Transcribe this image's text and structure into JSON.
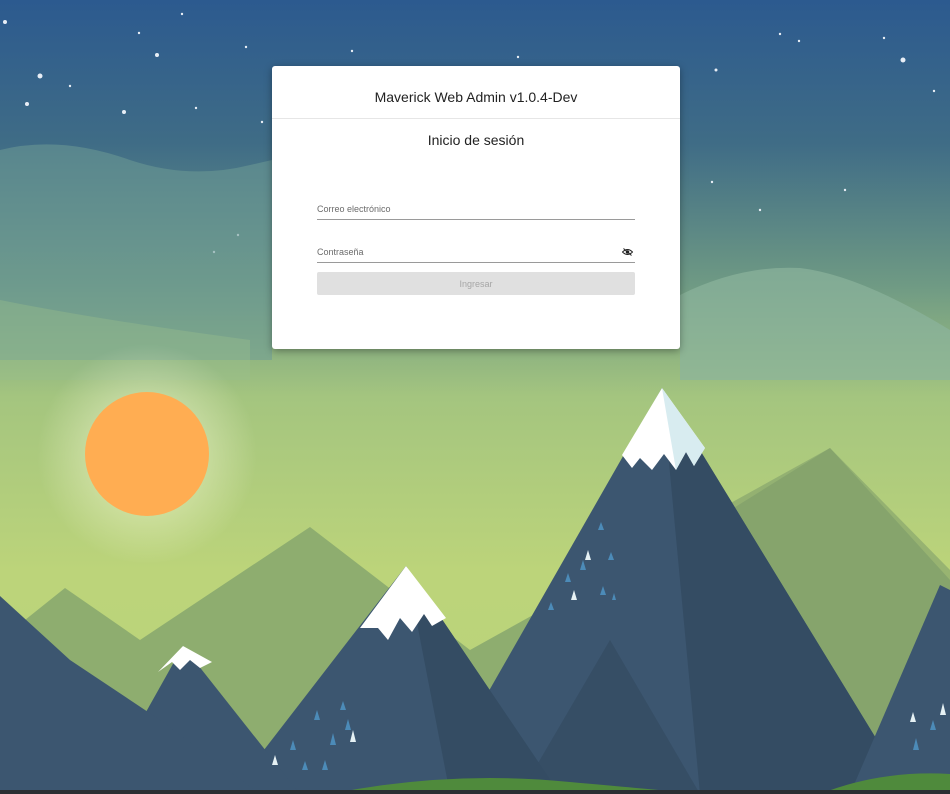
{
  "app": {
    "title": "Maverick Web Admin v1.0.4-Dev"
  },
  "login": {
    "heading": "Inicio de sesión",
    "email": {
      "placeholder": "Correo electrónico",
      "value": ""
    },
    "password": {
      "placeholder": "Contraseña",
      "value": "",
      "toggle_icon": "eye-off-icon"
    },
    "submit_label": "Ingresar",
    "submit_state": "disabled"
  },
  "colors": {
    "sky_top": "#2f5f93",
    "sky_bottom": "#b9d37a",
    "sun": "#ffad52",
    "mountain": "#3c5670",
    "snow": "#ffffff",
    "card": "#ffffff",
    "button_disabled": "#e0e0e0"
  }
}
